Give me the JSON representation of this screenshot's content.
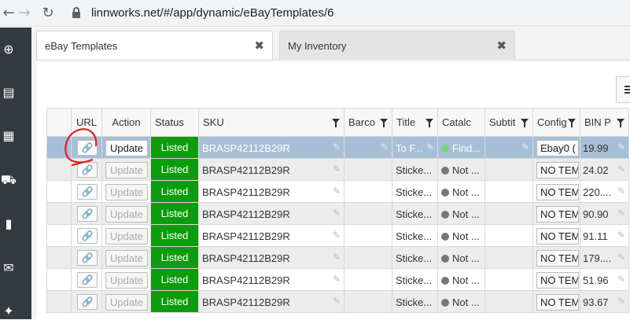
{
  "browser": {
    "url": "linnworks.net/#/app/dynamic/eBayTemplates/6",
    "icons": [
      "back-arrow-icon",
      "forward-arrow-icon",
      "reload-icon",
      "lock-icon"
    ]
  },
  "sidebar": {
    "icons": [
      "plus-circle-icon",
      "boxes-icon",
      "book-icon",
      "truck-icon",
      "bar-chart-icon",
      "envelope-icon",
      "puzzle-icon"
    ]
  },
  "tabs": [
    {
      "label": "eBay Templates",
      "active": true
    },
    {
      "label": "My Inventory",
      "active": false
    }
  ],
  "grid": {
    "columns": [
      "URL",
      "Action",
      "Status",
      "SKU",
      "Barco",
      "Title",
      "Catalc",
      "Subtit",
      "Config",
      "BIN P"
    ],
    "rows": [
      {
        "action": "Update",
        "status": "Listed",
        "sku": "BRASP42112B29R",
        "title": "To F...",
        "catalog": "Find...",
        "catalog_state": "green",
        "config": "Ebay0 (",
        "bin": "19.99",
        "selected": true
      },
      {
        "action": "Update",
        "status": "Listed",
        "sku": "BRASP42112B29R",
        "title": "Sticke...",
        "catalog": "Not ...",
        "catalog_state": "grey",
        "config": "NO TEM",
        "bin": "24.02"
      },
      {
        "action": "Update",
        "status": "Listed",
        "sku": "BRASP42112B29R",
        "title": "Sticke...",
        "catalog": "Not ...",
        "catalog_state": "grey",
        "config": "NO TEM",
        "bin": "220...."
      },
      {
        "action": "Update",
        "status": "Listed",
        "sku": "BRASP42112B29R",
        "title": "Sticke...",
        "catalog": "Not ...",
        "catalog_state": "grey",
        "config": "NO TEM",
        "bin": "90.90"
      },
      {
        "action": "Update",
        "status": "Listed",
        "sku": "BRASP42112B29R",
        "title": "Sticke...",
        "catalog": "Not ...",
        "catalog_state": "grey",
        "config": "NO TEM",
        "bin": "91.11"
      },
      {
        "action": "Update",
        "status": "Listed",
        "sku": "BRASP42112B29R",
        "title": "Sticke...",
        "catalog": "Not ...",
        "catalog_state": "grey",
        "config": "NO TEM",
        "bin": "179...."
      },
      {
        "action": "Update",
        "status": "Listed",
        "sku": "BRASP42112B29R",
        "title": "Sticke...",
        "catalog": "Not ...",
        "catalog_state": "grey",
        "config": "NO TEM",
        "bin": "51.96"
      },
      {
        "action": "Update",
        "status": "Listed",
        "sku": "BRASP42112B29R",
        "title": "Sticke...",
        "catalog": "Not ...",
        "catalog_state": "grey",
        "config": "NO TEM",
        "bin": "93.67"
      }
    ]
  },
  "colors": {
    "status_green": "#0e9c0e",
    "selected_row": "#a7bfd6",
    "sidebar": "#343a40",
    "annotation": "#e02020"
  }
}
